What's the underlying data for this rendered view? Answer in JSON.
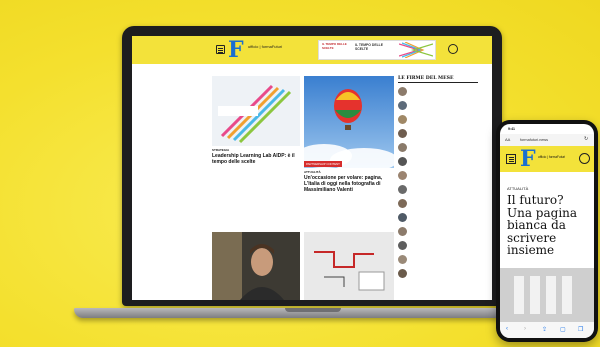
{
  "colors": {
    "background": "#f6e436",
    "brand_yellow": "#f3e23a",
    "brand_blue": "#1a6fd0",
    "accent_red": "#d62d2d",
    "link_blue": "#2a6fc9"
  },
  "laptop": {
    "header": {
      "logo_letter": "F",
      "logo_text": "ufficio | formaFuturi",
      "menu_icon": "hamburger-icon",
      "search_icon": "search-icon",
      "banner": {
        "left": "IL TEMPO DELLE SCELTE",
        "middle": "IL TEMPO DELLE SCELTE"
      }
    },
    "articles": [
      {
        "kicker": "STRATEGIA",
        "headline": "Leadership Learning Lab AIDP: è il tempo delle scelte",
        "banner_text": "IL TEMPO DELLE SCELTE"
      },
      {
        "kicker": "ATTUALITÀ",
        "headline": "Un'occasione per volare: pagina, L'Italia di oggi nella fotografia di Massimiliano Valenti",
        "tag": "PARTNERSHIP CONTENT"
      },
      {
        "kicker": "",
        "headline": ""
      },
      {
        "kicker": "",
        "headline": ""
      }
    ],
    "sidebar": {
      "title": "LE FIRME DEL MESE",
      "items": [
        {
          "title": "",
          "author": ""
        },
        {
          "title": "",
          "author": ""
        },
        {
          "title": "",
          "author": ""
        },
        {
          "title": "",
          "author": ""
        },
        {
          "title": "",
          "author": ""
        },
        {
          "title": "",
          "author": ""
        },
        {
          "title": "",
          "author": ""
        },
        {
          "title": "",
          "author": ""
        },
        {
          "title": "",
          "author": ""
        },
        {
          "title": "",
          "author": ""
        },
        {
          "title": "",
          "author": ""
        },
        {
          "title": "",
          "author": ""
        },
        {
          "title": "",
          "author": ""
        },
        {
          "title": "",
          "author": ""
        }
      ]
    }
  },
  "phone": {
    "url": "formafuturi.news",
    "aa_label": "AA",
    "reload_icon": "reload-icon",
    "logo_letter": "F",
    "logo_text": "ufficio | formaFuturi",
    "kicker": "ATTUALITÀ",
    "headline": "Il futuro? Una pagina bianca da scrivere insieme",
    "toolbar": [
      "<",
      ">",
      "share-icon",
      "book-icon",
      "tabs-icon"
    ]
  }
}
